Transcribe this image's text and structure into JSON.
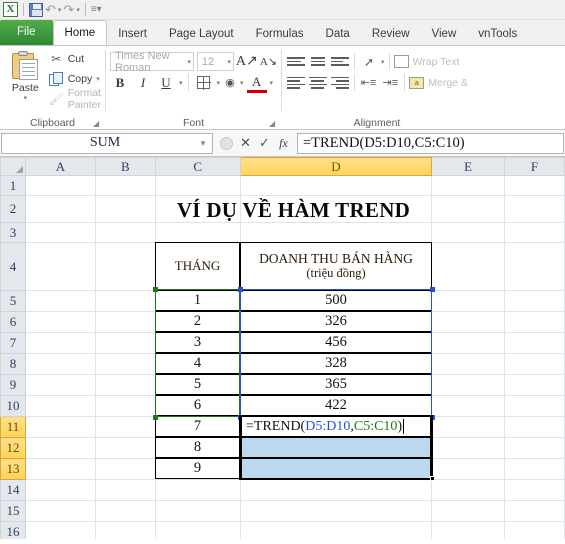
{
  "quick_access": {
    "logo": "excel-logo-icon",
    "buttons": [
      {
        "name": "save-icon",
        "label": "Save"
      },
      {
        "name": "undo-icon",
        "label": "Undo"
      },
      {
        "name": "redo-icon",
        "label": "Redo"
      },
      {
        "name": "customize-qat-icon",
        "label": "Customize Quick Access Toolbar"
      }
    ]
  },
  "ribbon": {
    "tabs": [
      {
        "label": "File",
        "active": false,
        "kind": "file"
      },
      {
        "label": "Home",
        "active": true,
        "kind": "normal"
      },
      {
        "label": "Insert",
        "active": false,
        "kind": "normal"
      },
      {
        "label": "Page Layout",
        "active": false,
        "kind": "normal"
      },
      {
        "label": "Formulas",
        "active": false,
        "kind": "normal"
      },
      {
        "label": "Data",
        "active": false,
        "kind": "normal"
      },
      {
        "label": "Review",
        "active": false,
        "kind": "normal"
      },
      {
        "label": "View",
        "active": false,
        "kind": "normal"
      },
      {
        "label": "vnTools",
        "active": false,
        "kind": "normal"
      }
    ],
    "groups": {
      "clipboard": {
        "label": "Clipboard",
        "paste_label": "Paste",
        "cut_label": "Cut",
        "copy_label": "Copy",
        "format_painter_label": "Format Painter"
      },
      "font": {
        "label": "Font",
        "font_name": "Times New Roman",
        "font_size": "12",
        "bold": "B",
        "italic": "I",
        "underline": "U",
        "grow_font": "A",
        "shrink_font": "A",
        "font_color_letter": "A"
      },
      "alignment": {
        "label": "Alignment",
        "wrap_text_label": "Wrap Text",
        "merge_label": "Merge &"
      }
    }
  },
  "formula_bar": {
    "name_box_value": "SUM",
    "cancel_label": "✕",
    "enter_label": "✓",
    "fx_label": "fx",
    "formula": "=TREND(D5:D10,C5:C10)"
  },
  "grid": {
    "columns": [
      "A",
      "B",
      "C",
      "D",
      "E",
      "F"
    ],
    "selected_column": "D",
    "rows": [
      "1",
      "2",
      "3",
      "4",
      "5",
      "6",
      "7",
      "8",
      "9",
      "10",
      "11",
      "12",
      "13",
      "14",
      "15",
      "16"
    ],
    "selected_rows": [
      "11",
      "12",
      "13"
    ]
  },
  "sheet": {
    "title": "VÍ DỤ VỀ HÀM TREND",
    "table_headers": {
      "month": "THÁNG",
      "revenue_line1": "DOANH THU BÁN HÀNG",
      "revenue_line2": "(triệu đồng)"
    },
    "table_rows": [
      {
        "row": "5",
        "month": "1",
        "revenue": "500"
      },
      {
        "row": "6",
        "month": "2",
        "revenue": "326"
      },
      {
        "row": "7",
        "month": "3",
        "revenue": "456"
      },
      {
        "row": "8",
        "month": "4",
        "revenue": "328"
      },
      {
        "row": "9",
        "month": "5",
        "revenue": "365"
      },
      {
        "row": "10",
        "month": "6",
        "revenue": "422"
      },
      {
        "row": "11",
        "month": "7",
        "revenue": ""
      },
      {
        "row": "12",
        "month": "8",
        "revenue": ""
      },
      {
        "row": "13",
        "month": "9",
        "revenue": ""
      }
    ],
    "edit_cell": {
      "address": "D11",
      "prefix": "=TREND(",
      "arg1": "D5:D10",
      "comma": ",",
      "arg2": "C5:C10",
      "suffix": ")"
    },
    "reference_highlights": [
      {
        "range": "C5:C10",
        "color": "#1a7a1a"
      },
      {
        "range": "D5:D10",
        "color": "#2a4fd6"
      }
    ]
  },
  "colors": {
    "selected_header": "#ffd25a",
    "selection_fill": "#bcd9f2",
    "ref_blue": "#2a4fd6",
    "ref_green": "#1a7a1a",
    "file_tab_green": "#2e8b33"
  }
}
